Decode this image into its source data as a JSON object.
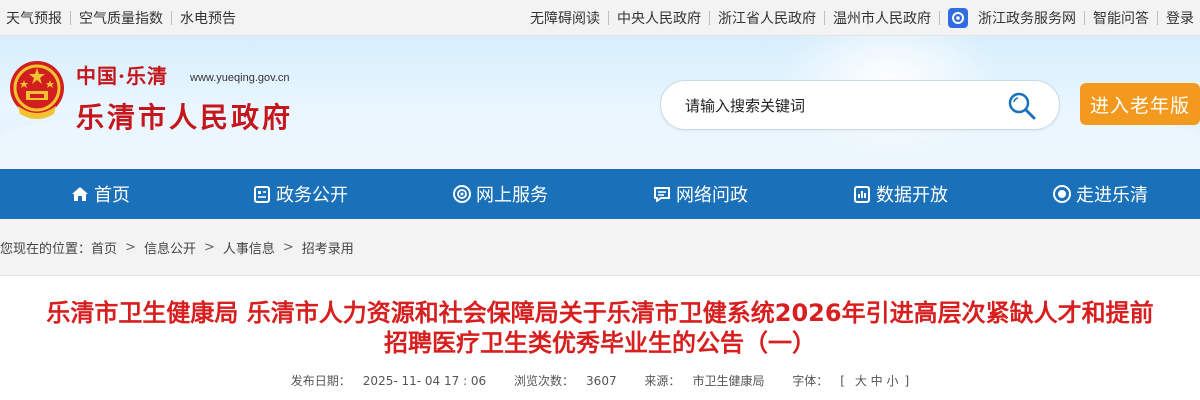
{
  "topbar": {
    "left_links": [
      "天气预报",
      "空气质量指数",
      "水电预告"
    ],
    "right_links": [
      "无障碍阅读",
      "中央人民政府",
      "浙江省人民政府",
      "温州市人民政府"
    ],
    "zwfw_label": "浙江政务服务网",
    "qa_label": "智能问答",
    "login_label": "登录"
  },
  "header": {
    "logo_line1": "中国·乐清",
    "logo_url": "www.yueqing.gov.cn",
    "logo_line2": "乐清市人民政府",
    "search_placeholder": "请输入搜索关键词",
    "elder_label": "进入老年版"
  },
  "nav": {
    "items": [
      {
        "label": "首页",
        "icon": "home-icon"
      },
      {
        "label": "政务公开",
        "icon": "document-icon"
      },
      {
        "label": "网上服务",
        "icon": "service-icon"
      },
      {
        "label": "网络问政",
        "icon": "chat-icon"
      },
      {
        "label": "数据开放",
        "icon": "data-icon"
      },
      {
        "label": "走进乐清",
        "icon": "eye-icon"
      }
    ]
  },
  "breadcrumb": {
    "prefix": "您现在的位置：",
    "items": [
      "首页",
      "信息公开",
      "人事信息",
      "招考录用"
    ],
    "separator": ">"
  },
  "article": {
    "title": "乐清市卫生健康局 乐清市人力资源和社会保障局关于乐清市卫健系统2026年引进高层次紧缺人才和提前招聘医疗卫生类优秀毕业生的公告（一）",
    "meta": {
      "date_label": "发布日期：",
      "date": "2025- 11- 04 17 : 06",
      "views_label": "浏览次数：",
      "views": "3607",
      "source_label": "来源：",
      "source": "市卫生健康局",
      "font_label": "字体：",
      "font_open": "[",
      "font_large": "大",
      "font_medium": "中",
      "font_small": "小",
      "font_close": "]"
    }
  },
  "colors": {
    "nav_bg": "#1a70b9",
    "title_red": "#d71f1f",
    "elder_orange": "#f39a1e",
    "logo_red": "#c5161c"
  }
}
